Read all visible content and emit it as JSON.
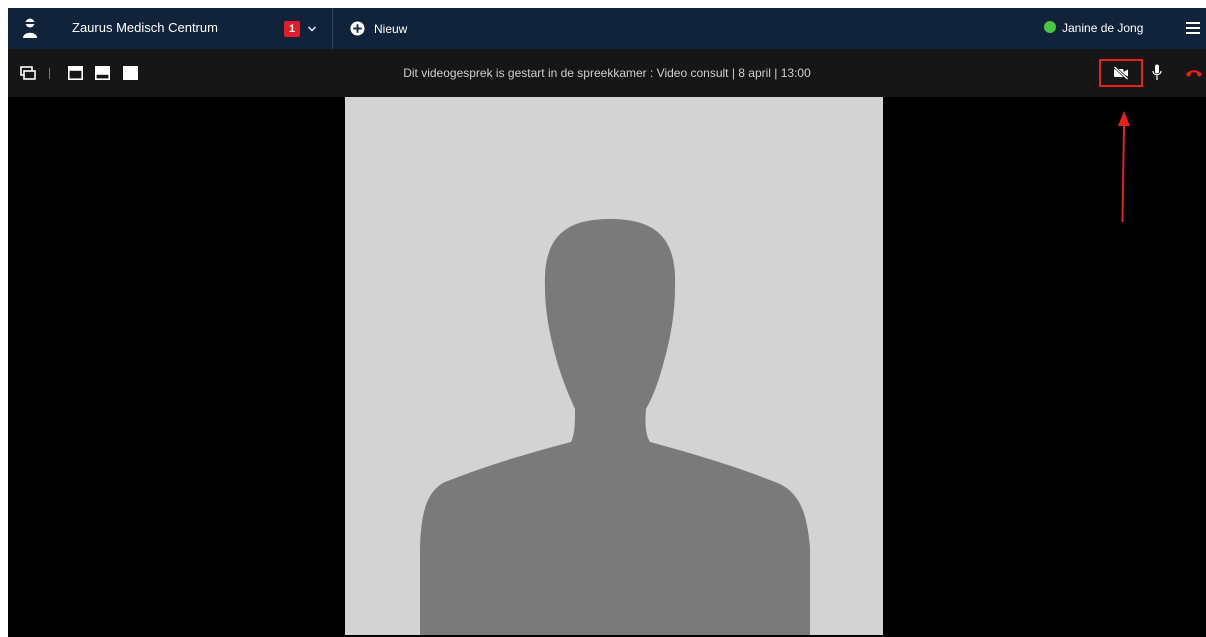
{
  "header": {
    "org_name": "Zaurus Medisch Centrum",
    "notification_count": "1",
    "new_label": "Nieuw",
    "user_name": "Janine de Jong",
    "user_status_color": "#47c83e"
  },
  "call": {
    "info_text": "Dit videogesprek is gestart in de spreekkamer : Video consult | 8 april | 13:00",
    "camera_state": "off",
    "hangup_color": "#e8201c"
  },
  "colors": {
    "topbar": "#10233a",
    "callbar": "#161616",
    "tile_background": "#d3d3d3",
    "silhouette": "#7a7a7a",
    "annotation": "#e8201c"
  },
  "icons": {
    "logo": "person-icon",
    "dropdown": "chevron-down-icon",
    "new": "plus-circle-icon",
    "menu": "hamburger-menu-icon",
    "popout": "popout-window-icon",
    "layouts": [
      "layout-top-icon",
      "layout-bottom-icon",
      "layout-full-icon"
    ],
    "camera": "camera-off-icon",
    "microphone": "microphone-icon",
    "hangup": "phone-hangup-icon"
  }
}
